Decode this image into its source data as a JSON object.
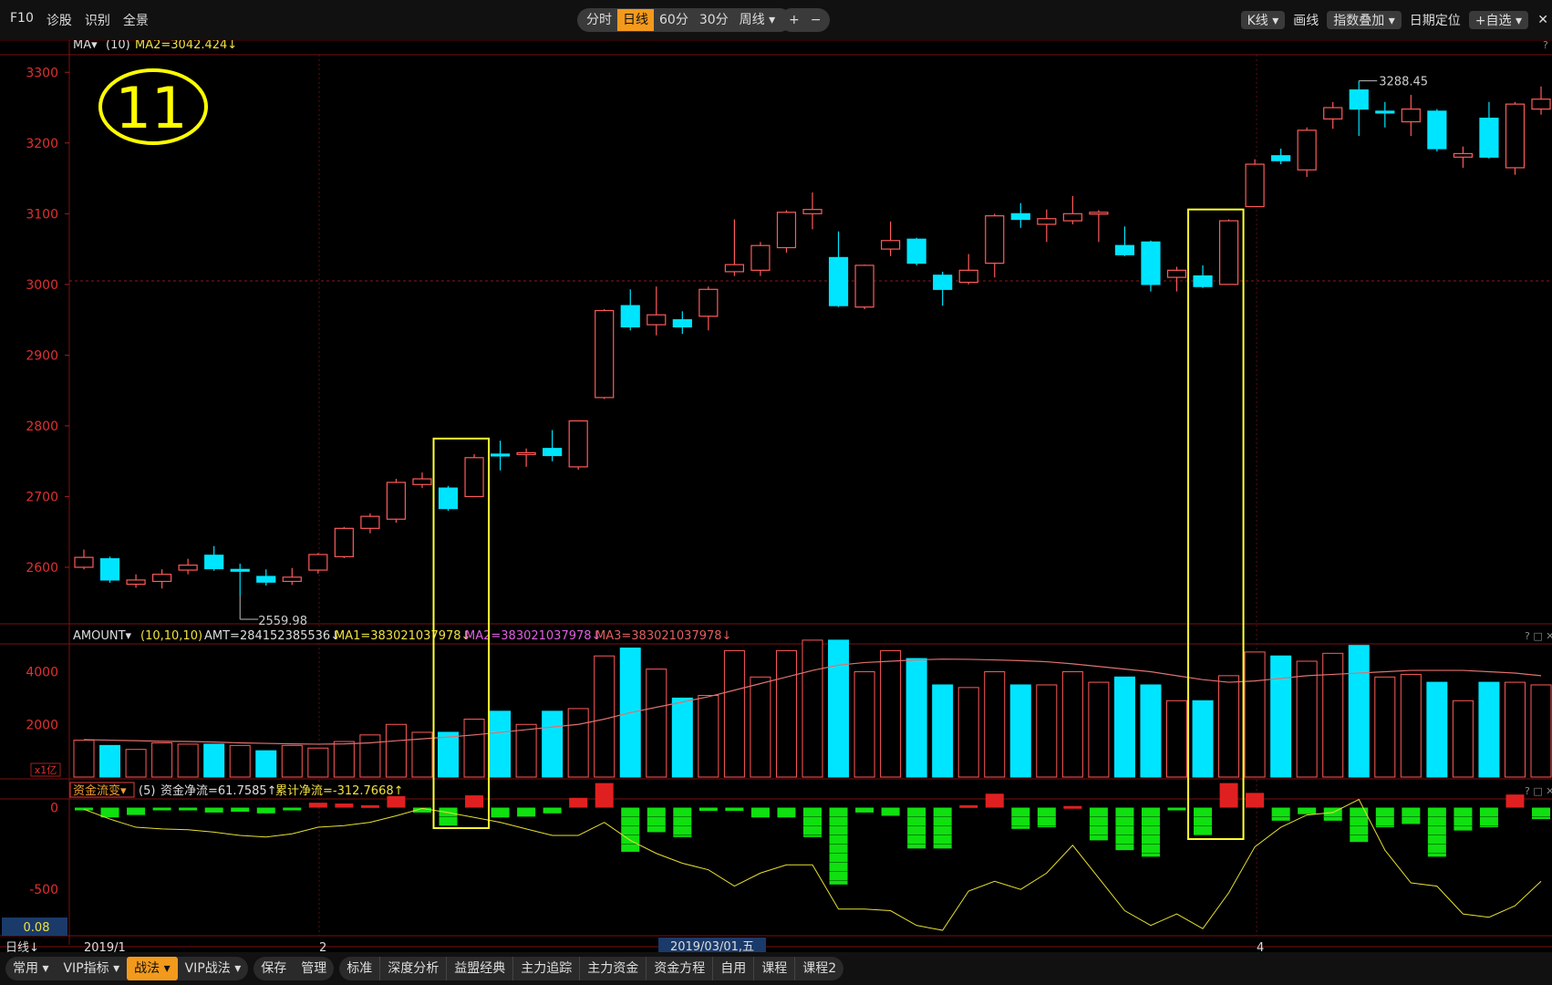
{
  "toolbar": {
    "left": [
      "F10",
      "诊股",
      "识别",
      "全景"
    ],
    "periods": [
      "分时",
      "日线",
      "60分",
      "30分",
      "周线 ▾"
    ],
    "active_period": "日线",
    "zoom_in": "+",
    "zoom_out": "−",
    "right": [
      "K线 ▾",
      "画线",
      "指数叠加 ▾",
      "日期定位",
      "+自选 ▾"
    ]
  },
  "badge_number": "11",
  "price_panel": {
    "indicator_label": "MA▾",
    "indicator_params": "(10)",
    "indicator_value": "MA2=3042.424↓",
    "y_ticks": [
      "3300",
      "3200",
      "3100",
      "3000",
      "2900",
      "2800",
      "2700",
      "2600"
    ],
    "low_label": "2559.98",
    "high_label": "3288.45"
  },
  "volume_panel": {
    "label": "AMOUNT▾",
    "params": "(10,10,10)",
    "amt": "AMT=284152385536↓",
    "ma1": "MA1=383021037978↓",
    "ma2": "MA2=383021037978↓",
    "ma3": "MA3=383021037978↓",
    "y_ticks": [
      "4000",
      "2000"
    ],
    "unit": "x1亿"
  },
  "flow_panel": {
    "label": "资金流变▾",
    "params": "(5)",
    "net": "资金净流=61.7585↑",
    "cum": "累计净流=-312.7668↑",
    "y_ticks": [
      "0",
      "-500"
    ],
    "corner_value": "0.08"
  },
  "x_axis": {
    "mode_label": "日线↓",
    "labels": [
      "2019/1",
      "2",
      "4"
    ],
    "cursor_date": "2019/03/01,五"
  },
  "bottom_tabs": {
    "group1": [
      "常用 ▾",
      "VIP指标 ▾",
      "战法 ▾",
      "VIP战法 ▾"
    ],
    "highlight": "战法 ▾",
    "group2": [
      "保存",
      "管理"
    ],
    "group3": [
      "标准",
      "深度分析",
      "益盟经典",
      "主力追踪",
      "主力资金",
      "资金方程",
      "自用",
      "课程",
      "课程2"
    ]
  },
  "colors": {
    "up": "#ff5a5a",
    "down": "#00e5ff",
    "flow_pos": "#e02020",
    "flow_neg": "#10e010",
    "highlight": "#ffff30",
    "ma_line": "#e07070",
    "axis_text": "#e03030"
  },
  "chart_data": {
    "type": "candlestick",
    "candles": [
      {
        "o": 2600,
        "c": 2614,
        "h": 2625,
        "l": 2597,
        "v": 1400,
        "f": -3
      },
      {
        "o": 2612,
        "c": 2582,
        "h": 2615,
        "l": 2578,
        "v": 1200,
        "f": -60
      },
      {
        "o": 2576,
        "c": 2582,
        "h": 2590,
        "l": 2571,
        "v": 1050,
        "f": -45
      },
      {
        "o": 2580,
        "c": 2590,
        "h": 2597,
        "l": 2570,
        "v": 1300,
        "f": -10
      },
      {
        "o": 2596,
        "c": 2603,
        "h": 2612,
        "l": 2590,
        "v": 1250,
        "f": -8
      },
      {
        "o": 2617,
        "c": 2598,
        "h": 2630,
        "l": 2595,
        "v": 1250,
        "f": -30
      },
      {
        "o": 2597,
        "c": 2597,
        "h": 2605,
        "l": 2560,
        "v": 1200,
        "f": -25
      },
      {
        "o": 2587,
        "c": 2579,
        "h": 2597,
        "l": 2574,
        "v": 1000,
        "f": -35
      },
      {
        "o": 2580,
        "c": 2586,
        "h": 2599,
        "l": 2575,
        "v": 1200,
        "f": -8
      },
      {
        "o": 2596,
        "c": 2618,
        "h": 2620,
        "l": 2591,
        "v": 1100,
        "f": 30
      },
      {
        "o": 2615,
        "c": 2655,
        "h": 2657,
        "l": 2613,
        "v": 1350,
        "f": 25
      },
      {
        "o": 2655,
        "c": 2672,
        "h": 2676,
        "l": 2648,
        "v": 1600,
        "f": 15
      },
      {
        "o": 2668,
        "c": 2720,
        "h": 2725,
        "l": 2663,
        "v": 2000,
        "f": 70
      },
      {
        "o": 2717,
        "c": 2725,
        "h": 2734,
        "l": 2712,
        "v": 1700,
        "f": -30
      },
      {
        "o": 2712,
        "c": 2683,
        "h": 2715,
        "l": 2680,
        "v": 1700,
        "f": -110
      },
      {
        "o": 2700,
        "c": 2755,
        "h": 2760,
        "l": 2700,
        "v": 2200,
        "f": 75
      },
      {
        "o": 2760,
        "c": 2758,
        "h": 2779,
        "l": 2737,
        "v": 2500,
        "f": -60
      },
      {
        "o": 2760,
        "c": 2762,
        "h": 2768,
        "l": 2742,
        "v": 2000,
        "f": -55
      },
      {
        "o": 2768,
        "c": 2758,
        "h": 2794,
        "l": 2750,
        "v": 2500,
        "f": -35
      },
      {
        "o": 2742,
        "c": 2807,
        "h": 2807,
        "l": 2738,
        "v": 2600,
        "f": 60
      },
      {
        "o": 2840,
        "c": 2963,
        "h": 2965,
        "l": 2838,
        "v": 4600,
        "f": 150
      },
      {
        "o": 2970,
        "c": 2940,
        "h": 2993,
        "l": 2935,
        "v": 4900,
        "f": -270
      },
      {
        "o": 2943,
        "c": 2957,
        "h": 2997,
        "l": 2928,
        "v": 4100,
        "f": -150
      },
      {
        "o": 2950,
        "c": 2940,
        "h": 2962,
        "l": 2930,
        "v": 3000,
        "f": -180
      },
      {
        "o": 2955,
        "c": 2993,
        "h": 2997,
        "l": 2935,
        "v": 3100,
        "f": -20
      },
      {
        "o": 3018,
        "c": 3028,
        "h": 3092,
        "l": 3012,
        "v": 4800,
        "f": -20
      },
      {
        "o": 3020,
        "c": 3055,
        "h": 3060,
        "l": 3012,
        "v": 3800,
        "f": -60
      },
      {
        "o": 3052,
        "c": 3102,
        "h": 3105,
        "l": 3045,
        "v": 4800,
        "f": -60
      },
      {
        "o": 3100,
        "c": 3106,
        "h": 3130,
        "l": 3078,
        "v": 5200,
        "f": -180
      },
      {
        "o": 3038,
        "c": 2970,
        "h": 3075,
        "l": 2968,
        "v": 5200,
        "f": -470
      },
      {
        "o": 2968,
        "c": 3027,
        "h": 3028,
        "l": 2965,
        "v": 4000,
        "f": -30
      },
      {
        "o": 3050,
        "c": 3062,
        "h": 3089,
        "l": 3040,
        "v": 4800,
        "f": -50
      },
      {
        "o": 3064,
        "c": 3030,
        "h": 3066,
        "l": 3027,
        "v": 4500,
        "f": -250
      },
      {
        "o": 3013,
        "c": 2993,
        "h": 3018,
        "l": 2970,
        "v": 3500,
        "f": -250
      },
      {
        "o": 3003,
        "c": 3020,
        "h": 3043,
        "l": 3000,
        "v": 3400,
        "f": 15
      },
      {
        "o": 3030,
        "c": 3097,
        "h": 3100,
        "l": 3010,
        "v": 4000,
        "f": 85
      },
      {
        "o": 3100,
        "c": 3092,
        "h": 3115,
        "l": 3080,
        "v": 3500,
        "f": -130
      },
      {
        "o": 3085,
        "c": 3093,
        "h": 3106,
        "l": 3060,
        "v": 3500,
        "f": -120
      },
      {
        "o": 3090,
        "c": 3100,
        "h": 3125,
        "l": 3085,
        "v": 4000,
        "f": 10
      },
      {
        "o": 3100,
        "c": 3102,
        "h": 3105,
        "l": 3060,
        "v": 3600,
        "f": -200
      },
      {
        "o": 3055,
        "c": 3042,
        "h": 3082,
        "l": 3040,
        "v": 3800,
        "f": -260
      },
      {
        "o": 3060,
        "c": 3000,
        "h": 3062,
        "l": 2990,
        "v": 3500,
        "f": -300
      },
      {
        "o": 3010,
        "c": 3020,
        "h": 3025,
        "l": 2990,
        "v": 2900,
        "f": -5
      },
      {
        "o": 3012,
        "c": 2997,
        "h": 3027,
        "l": 2995,
        "v": 2900,
        "f": -170
      },
      {
        "o": 3000,
        "c": 3090,
        "h": 3092,
        "l": 3000,
        "v": 3850,
        "f": 150
      },
      {
        "o": 3110,
        "c": 3170,
        "h": 3177,
        "l": 3110,
        "v": 4750,
        "f": 90
      },
      {
        "o": 3182,
        "c": 3175,
        "h": 3192,
        "l": 3170,
        "v": 4600,
        "f": -80
      },
      {
        "o": 3162,
        "c": 3218,
        "h": 3222,
        "l": 3152,
        "v": 4400,
        "f": -40
      },
      {
        "o": 3234,
        "c": 3250,
        "h": 3258,
        "l": 3220,
        "v": 4700,
        "f": -80
      },
      {
        "o": 3275,
        "c": 3248,
        "h": 3288,
        "l": 3210,
        "v": 5000,
        "f": -210
      },
      {
        "o": 3245,
        "c": 3245,
        "h": 3258,
        "l": 3222,
        "v": 3800,
        "f": -120
      },
      {
        "o": 3230,
        "c": 3248,
        "h": 3268,
        "l": 3210,
        "v": 3900,
        "f": -100
      },
      {
        "o": 3245,
        "c": 3192,
        "h": 3248,
        "l": 3188,
        "v": 3600,
        "f": -300
      },
      {
        "o": 3180,
        "c": 3185,
        "h": 3195,
        "l": 3165,
        "v": 2900,
        "f": -140
      },
      {
        "o": 3235,
        "c": 3180,
        "h": 3258,
        "l": 3178,
        "v": 3600,
        "f": -120
      },
      {
        "o": 3165,
        "c": 3255,
        "h": 3258,
        "l": 3155,
        "v": 3600,
        "f": 80
      },
      {
        "o": 3248,
        "c": 3262,
        "h": 3280,
        "l": 3240,
        "v": 3500,
        "f": -70
      }
    ],
    "volume_ma": [
      1420,
      1400,
      1380,
      1360,
      1350,
      1330,
      1300,
      1280,
      1260,
      1250,
      1260,
      1300,
      1380,
      1450,
      1520,
      1600,
      1700,
      1800,
      1900,
      2000,
      2200,
      2450,
      2650,
      2850,
      3050,
      3300,
      3550,
      3800,
      4050,
      4250,
      4350,
      4400,
      4450,
      4480,
      4470,
      4450,
      4420,
      4380,
      4300,
      4200,
      4100,
      4000,
      3850,
      3700,
      3600,
      3650,
      3750,
      3850,
      3900,
      3950,
      4000,
      4050,
      4050,
      4050,
      4000,
      3950,
      3850
    ],
    "cum_flow": [
      -10,
      -70,
      -120,
      -130,
      -135,
      -150,
      -170,
      -180,
      -160,
      -120,
      -110,
      -90,
      -50,
      -5,
      -30,
      -60,
      -90,
      -130,
      -170,
      -170,
      -90,
      -200,
      -280,
      -340,
      -380,
      -480,
      -400,
      -350,
      -350,
      -620,
      -620,
      -630,
      -720,
      -750,
      -510,
      -450,
      -500,
      -400,
      -230,
      -430,
      -630,
      -720,
      -650,
      -740,
      -520,
      -240,
      -120,
      -45,
      -30,
      50,
      -260,
      -460,
      -480,
      -650,
      -670,
      -600,
      -450
    ],
    "price_ylim": [
      2520,
      3330
    ],
    "volume_ylim": [
      0,
      5300
    ],
    "flow_ylim": [
      -800,
      120
    ],
    "highlight_boxes": [
      [
        14,
        15
      ],
      [
        43,
        44
      ]
    ]
  }
}
